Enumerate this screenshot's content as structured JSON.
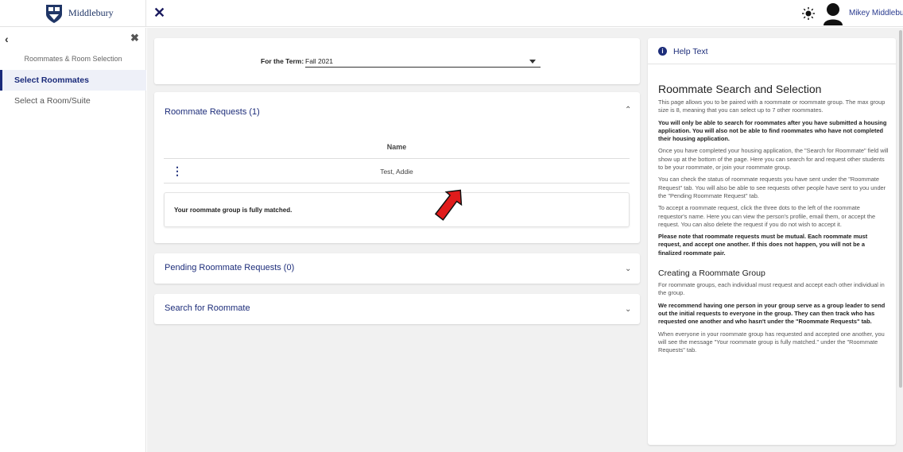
{
  "header": {
    "logo_text": "Middlebury",
    "close_icon": "close-icon",
    "theme_icon": "sun-icon",
    "user_name": "Mikey Middlebury"
  },
  "sidebar": {
    "back_icon": "chevron-left-icon",
    "close_icon": "close-icon",
    "heading": "Roommates & Room Selection",
    "items": [
      {
        "label": "Select Roommates",
        "active": true
      },
      {
        "label": "Select a Room/Suite",
        "active": false
      }
    ]
  },
  "term": {
    "label": "For the Term:",
    "value": "Fall 2021"
  },
  "roommate_requests": {
    "title": "Roommate Requests (1)",
    "column_name": "Name",
    "rows": [
      {
        "name": "Test, Addie"
      }
    ],
    "status": "Your roommate group is fully matched."
  },
  "pending_requests": {
    "title": "Pending Roommate Requests (0)"
  },
  "search_roommate": {
    "title": "Search for Roommate"
  },
  "help": {
    "title": "Help Text",
    "heading": "Roommate Search and Selection",
    "p1": "This page allows you to be paired with a roommate or roommate group. The max group size is 8, meaning that you can select up to 7 other roommates.",
    "p2": "You will only be able to search for roommates after you have submitted a housing application. You will also not be able to find roommates who have not completed their housing application.",
    "p3": "Once you have completed your housing application, the \"Search for Roommate\" field will show up at the bottom of the page. Here you can search for and request other students to be your roommate, or join your roommate group.",
    "p4": "You can check the status of roommate requests you have sent under the \"Roommate Request\" tab. You will also be able to see requests other people have sent to you under the \"Pending Roommate Request\" tab.",
    "p5": "To accept a roommate request, click the three dots to the left of the roommate requestor's name. Here you can view the person's profile, email them, or accept the request. You can also delete the request if you do not wish to accept it.",
    "p6": "Please note that roommate requests must be mutual. Each roommate must request, and accept one another. If this does not happen, you will not be a finalized roommate pair.",
    "subheading": "Creating a Roommate Group",
    "p7": "For roommate groups, each individual must request and accept each other individual in the group.",
    "p8": "We recommend having one person in your group serve as a group leader to send out the initial requests to everyone in the group. They can then track who has requested one another and who hasn't under the \"Roommate Requests\" tab.",
    "p9": "When everyone in your roommate group has requested and accepted one another, you will see the message \"Your roommate group is fully matched.\" under the \"Roommate Requests\" tab."
  },
  "colors": {
    "accent": "#1d2d7a",
    "annotation_arrow": "#e01b1b"
  }
}
